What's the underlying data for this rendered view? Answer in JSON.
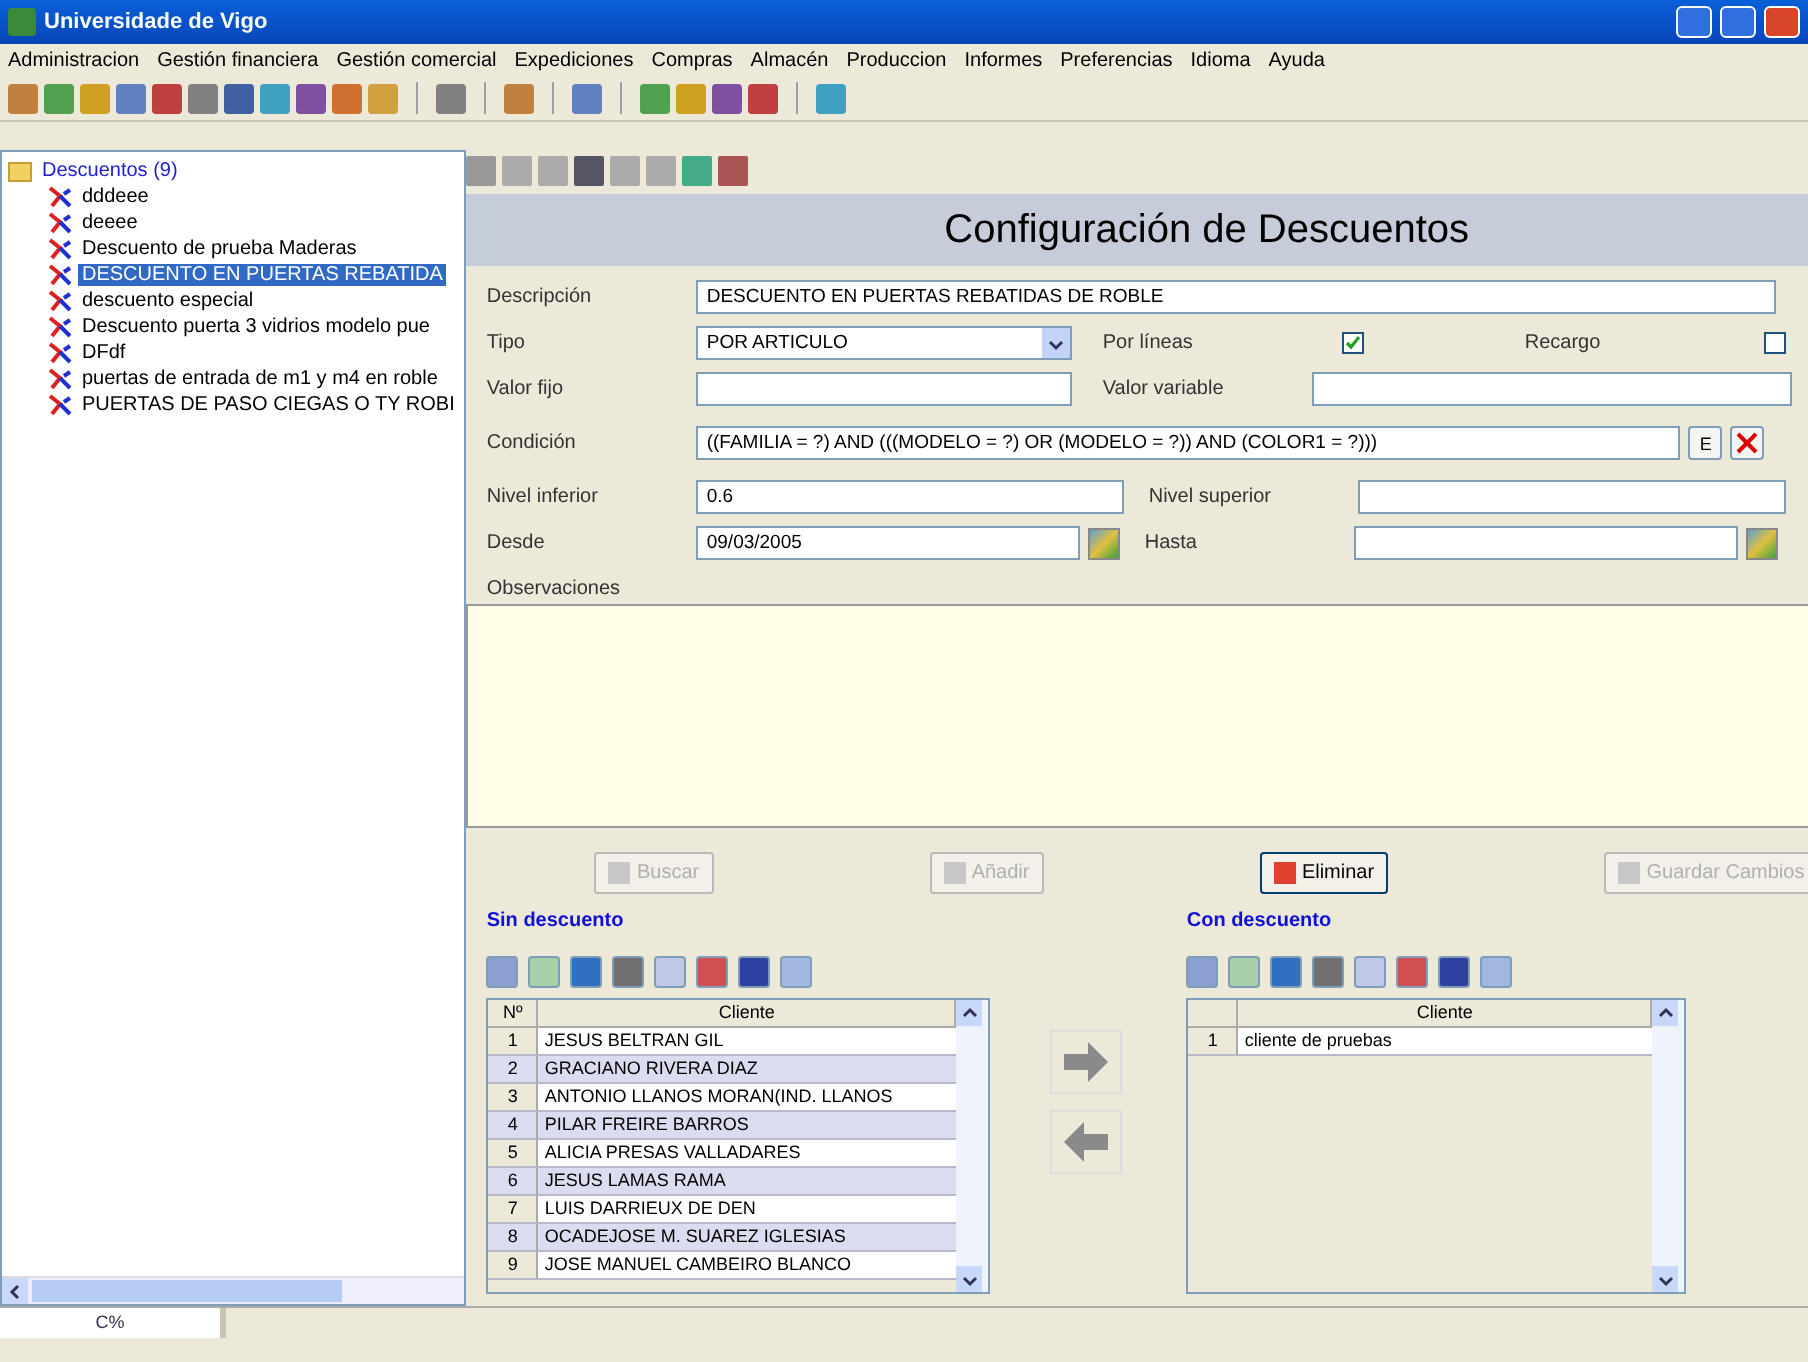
{
  "window": {
    "title": "Universidade de Vigo"
  },
  "menu": [
    "Administracion",
    "Gestión financiera",
    "Gestión comercial",
    "Expediciones",
    "Compras",
    "Almacén",
    "Produccion",
    "Informes",
    "Preferencias",
    "Idioma",
    "Ayuda"
  ],
  "tree": {
    "label": "Descuentos (9)",
    "children": [
      {
        "label": "dddeee",
        "selected": false
      },
      {
        "label": "deeee",
        "selected": false
      },
      {
        "label": "Descuento de prueba Maderas",
        "selected": false
      },
      {
        "label": "DESCUENTO EN PUERTAS REBATIDA",
        "selected": true
      },
      {
        "label": "descuento especial",
        "selected": false
      },
      {
        "label": "Descuento puerta 3 vidrios modelo pue",
        "selected": false
      },
      {
        "label": "DFdf",
        "selected": false
      },
      {
        "label": "puertas de entrada de m1 y m4 en roble",
        "selected": false
      },
      {
        "label": "PUERTAS DE PASO CIEGAS O TY ROBI",
        "selected": false
      }
    ]
  },
  "form": {
    "title": "Configuración de Descuentos",
    "descripcion": {
      "label": "Descripción",
      "value": "DESCUENTO EN PUERTAS REBATIDAS DE ROBLE"
    },
    "tipo": {
      "label": "Tipo",
      "value": "POR ARTICULO"
    },
    "por_lineas": {
      "label": "Por líneas",
      "checked": true
    },
    "recargo": {
      "label": "Recargo",
      "checked": false
    },
    "valor_fijo": {
      "label": "Valor fijo"
    },
    "valor_variable": {
      "label": "Valor variable"
    },
    "condicion": {
      "label": "Condición",
      "value": "((FAMILIA = ?) AND (((MODELO = ?) OR (MODELO = ?)) AND (COLOR1 = ?)))",
      "edit_button": "E"
    },
    "nivel_inferior": {
      "label": "Nivel inferior",
      "value": "0.6"
    },
    "nivel_superior": {
      "label": "Nivel superior"
    },
    "desde": {
      "label": "Desde",
      "value": "09/03/2005"
    },
    "hasta": {
      "label": "Hasta"
    },
    "observaciones": {
      "label": "Observaciones"
    }
  },
  "buttons": [
    {
      "label": "Buscar",
      "disabled": true
    },
    {
      "label": "Añadir",
      "disabled": true
    },
    {
      "label": "Eliminar",
      "disabled": false
    },
    {
      "label": "Guardar Cambios",
      "disabled": true
    }
  ],
  "sin_descuento": {
    "title": "Sin descuento",
    "columns": [
      "Nº",
      "Cliente"
    ],
    "rows": [
      [
        "1",
        "JESUS BELTRAN GIL"
      ],
      [
        "2",
        "GRACIANO RIVERA DIAZ"
      ],
      [
        "3",
        "ANTONIO LLANOS MORAN(IND. LLANOS"
      ],
      [
        "4",
        "PILAR FREIRE BARROS"
      ],
      [
        "5",
        "ALICIA PRESAS VALLADARES"
      ],
      [
        "6",
        "JESUS LAMAS RAMA"
      ],
      [
        "7",
        "LUIS DARRIEUX DE DEN"
      ],
      [
        "8",
        "OCADEJOSE M. SUAREZ IGLESIAS"
      ],
      [
        "9",
        "JOSE MANUEL CAMBEIRO BLANCO"
      ]
    ]
  },
  "con_descuento": {
    "title": "Con descuento",
    "columns": [
      "Cliente"
    ],
    "rows": [
      [
        "1",
        "cliente de pruebas"
      ]
    ]
  },
  "status_bar": {
    "text": "C%"
  }
}
